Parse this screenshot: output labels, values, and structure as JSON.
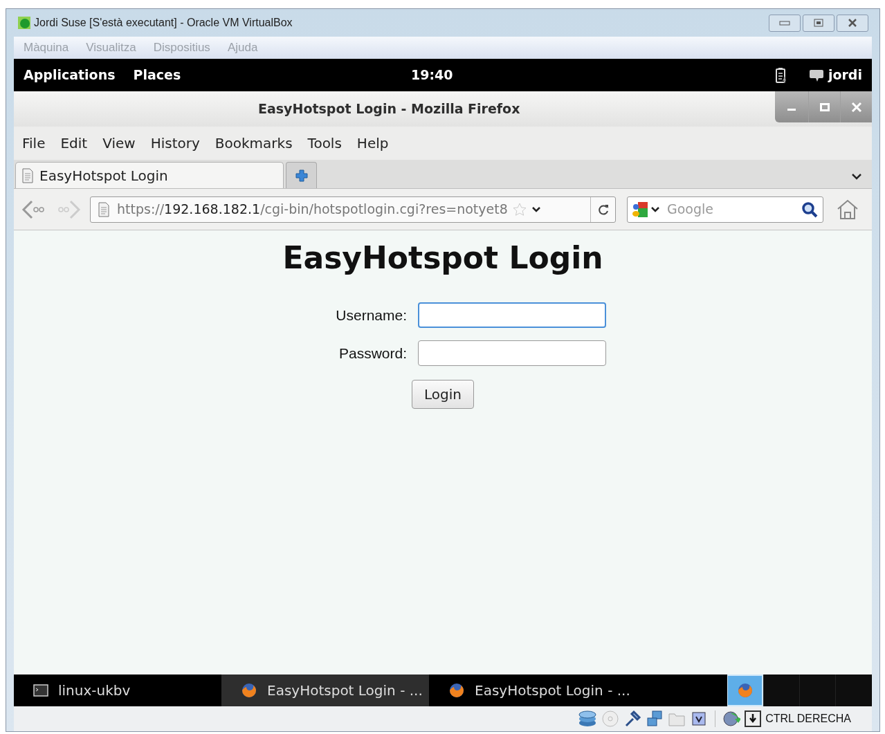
{
  "host_window": {
    "title": "Jordi Suse [S'està executant] - Oracle VM VirtualBox",
    "menu": [
      "Màquina",
      "Visualitza",
      "Dispositius",
      "Ajuda"
    ],
    "host_key": "CTRL DERECHA"
  },
  "top_panel": {
    "menus": [
      "Applications",
      "Places"
    ],
    "clock": "19:40",
    "user": "jordi"
  },
  "firefox": {
    "title": "EasyHotspot Login - Mozilla Firefox",
    "menu": [
      "File",
      "Edit",
      "View",
      "History",
      "Bookmarks",
      "Tools",
      "Help"
    ],
    "tabs": [
      {
        "label": "EasyHotspot Login",
        "selected": true
      }
    ],
    "url": "https://**192.168.182.1**/cgi-bin/hotspotlogin.cgi?res=notyet8",
    "search": {
      "placeholder": "Google"
    }
  },
  "page": {
    "heading": "EasyHotspot Login",
    "fields": [
      {
        "label": "Username:",
        "focused": true
      },
      {
        "label": "Password:",
        "focused": false
      }
    ],
    "button": "Login"
  },
  "taskbar": {
    "items": [
      {
        "label": "linux-ukbv",
        "kind": "terminal",
        "selected": false
      },
      {
        "label": "EasyHotspot Login - ...",
        "kind": "browser",
        "selected": true
      },
      {
        "label": "EasyHotspot Login - ...",
        "kind": "browser",
        "selected": false
      }
    ],
    "workspaces": [
      {
        "selected": true
      },
      {
        "selected": false
      },
      {
        "selected": false
      },
      {
        "selected": false
      }
    ]
  }
}
